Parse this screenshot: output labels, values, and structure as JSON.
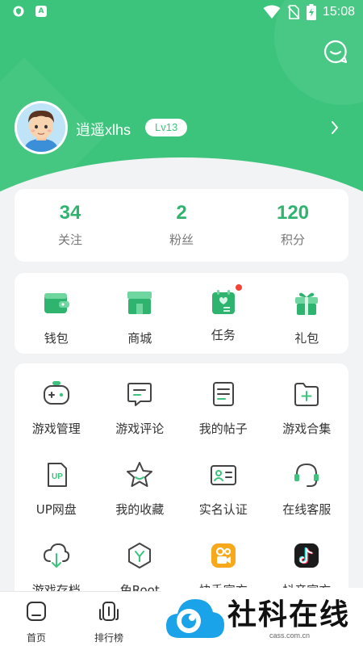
{
  "status_bar": {
    "time": "15:08",
    "left_icons": [
      "shield-icon",
      "a-icon"
    ],
    "right_icons": [
      "wifi-icon",
      "no-sim-icon",
      "battery-charging-icon"
    ]
  },
  "theme": {
    "primary": "#3cc47c",
    "accent_text": "#2eb46f",
    "background": "#f2f3f5",
    "badge_red": "#f44336"
  },
  "header": {
    "message_icon": "chat-bubble-icon"
  },
  "profile": {
    "username": "逍遥xlhs",
    "level": "Lv13",
    "avatar": "cartoon-boy-avatar"
  },
  "stats": [
    {
      "value": "34",
      "label": "关注"
    },
    {
      "value": "2",
      "label": "粉丝"
    },
    {
      "value": "120",
      "label": "积分"
    }
  ],
  "quick_actions": [
    {
      "label": "钱包",
      "icon": "wallet-icon"
    },
    {
      "label": "商城",
      "icon": "store-icon"
    },
    {
      "label": "任务",
      "icon": "task-icon",
      "has_badge": true
    },
    {
      "label": "礼包",
      "icon": "gift-icon"
    }
  ],
  "tools": [
    {
      "label": "游戏管理",
      "icon": "gamepad-icon"
    },
    {
      "label": "游戏评论",
      "icon": "comment-icon"
    },
    {
      "label": "我的帖子",
      "icon": "posts-icon"
    },
    {
      "label": "游戏合集",
      "icon": "collection-icon"
    },
    {
      "label": "UP网盘",
      "icon": "up-drive-icon"
    },
    {
      "label": "我的收藏",
      "icon": "star-icon"
    },
    {
      "label": "实名认证",
      "icon": "id-card-icon"
    },
    {
      "label": "在线客服",
      "icon": "headset-icon"
    },
    {
      "label": "游戏存档",
      "icon": "cloud-download-icon"
    },
    {
      "label": "免Root",
      "icon": "hexagon-y-icon"
    },
    {
      "label": "快手官方",
      "icon": "kuaishou-icon"
    },
    {
      "label": "抖音官方",
      "icon": "douyin-icon"
    }
  ],
  "tabbar": [
    {
      "label": "首页",
      "icon": "home-icon"
    },
    {
      "label": "排行榜",
      "icon": "ranking-icon"
    }
  ],
  "watermark": {
    "text": "社科在线",
    "url": "cass.com.cn"
  }
}
